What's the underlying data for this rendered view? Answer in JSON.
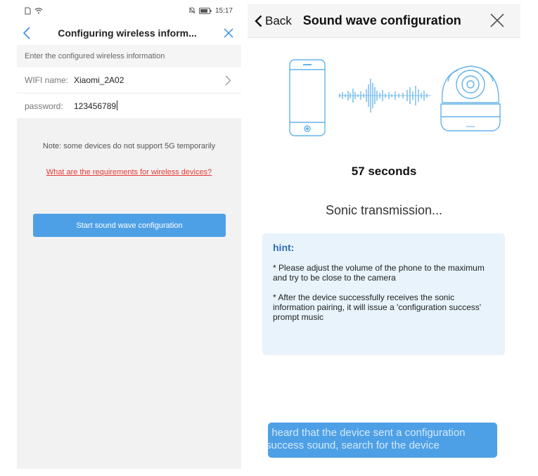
{
  "left_screen": {
    "status_bar": {
      "time": "15:17"
    },
    "header": {
      "title": "Configuring wireless inform..."
    },
    "section_label": "Enter the configured wireless information",
    "wifi": {
      "label": "WIFI name:",
      "value": "Xiaomi_2A02"
    },
    "password": {
      "label": "password:",
      "value": "123456789"
    },
    "note": "Note: some devices do not support 5G temporarily",
    "requirements_link": "What are the requirements for wireless devices?",
    "start_button": "Start sound wave configuration"
  },
  "right_screen": {
    "header": {
      "back_label": "Back",
      "title": "Sound wave configuration"
    },
    "countdown": "57 seconds",
    "status": "Sonic transmission...",
    "hint": {
      "title": "hint:",
      "items": [
        "* Please adjust the volume of the phone to the maximum and try to be close to the camera",
        "* After the device successfully receives the sonic information pairing, it will issue a 'configuration success' prompt music"
      ]
    },
    "bottom_button": {
      "line1": "I heard that the device sent a configuration",
      "line2": "success sound, search for the device"
    }
  },
  "colors": {
    "accent_blue": "#4ea0e6",
    "link_red": "#e53935",
    "hint_bg": "#e8f3fc",
    "illustration_blue": "#62b3ea"
  },
  "icons": [
    "sim-icon",
    "wifi-icon",
    "mute-icon",
    "battery-icon",
    "back-chevron-icon",
    "close-icon",
    "right-chevron-icon",
    "phone-icon",
    "sound-wave-icon",
    "camera-icon"
  ]
}
